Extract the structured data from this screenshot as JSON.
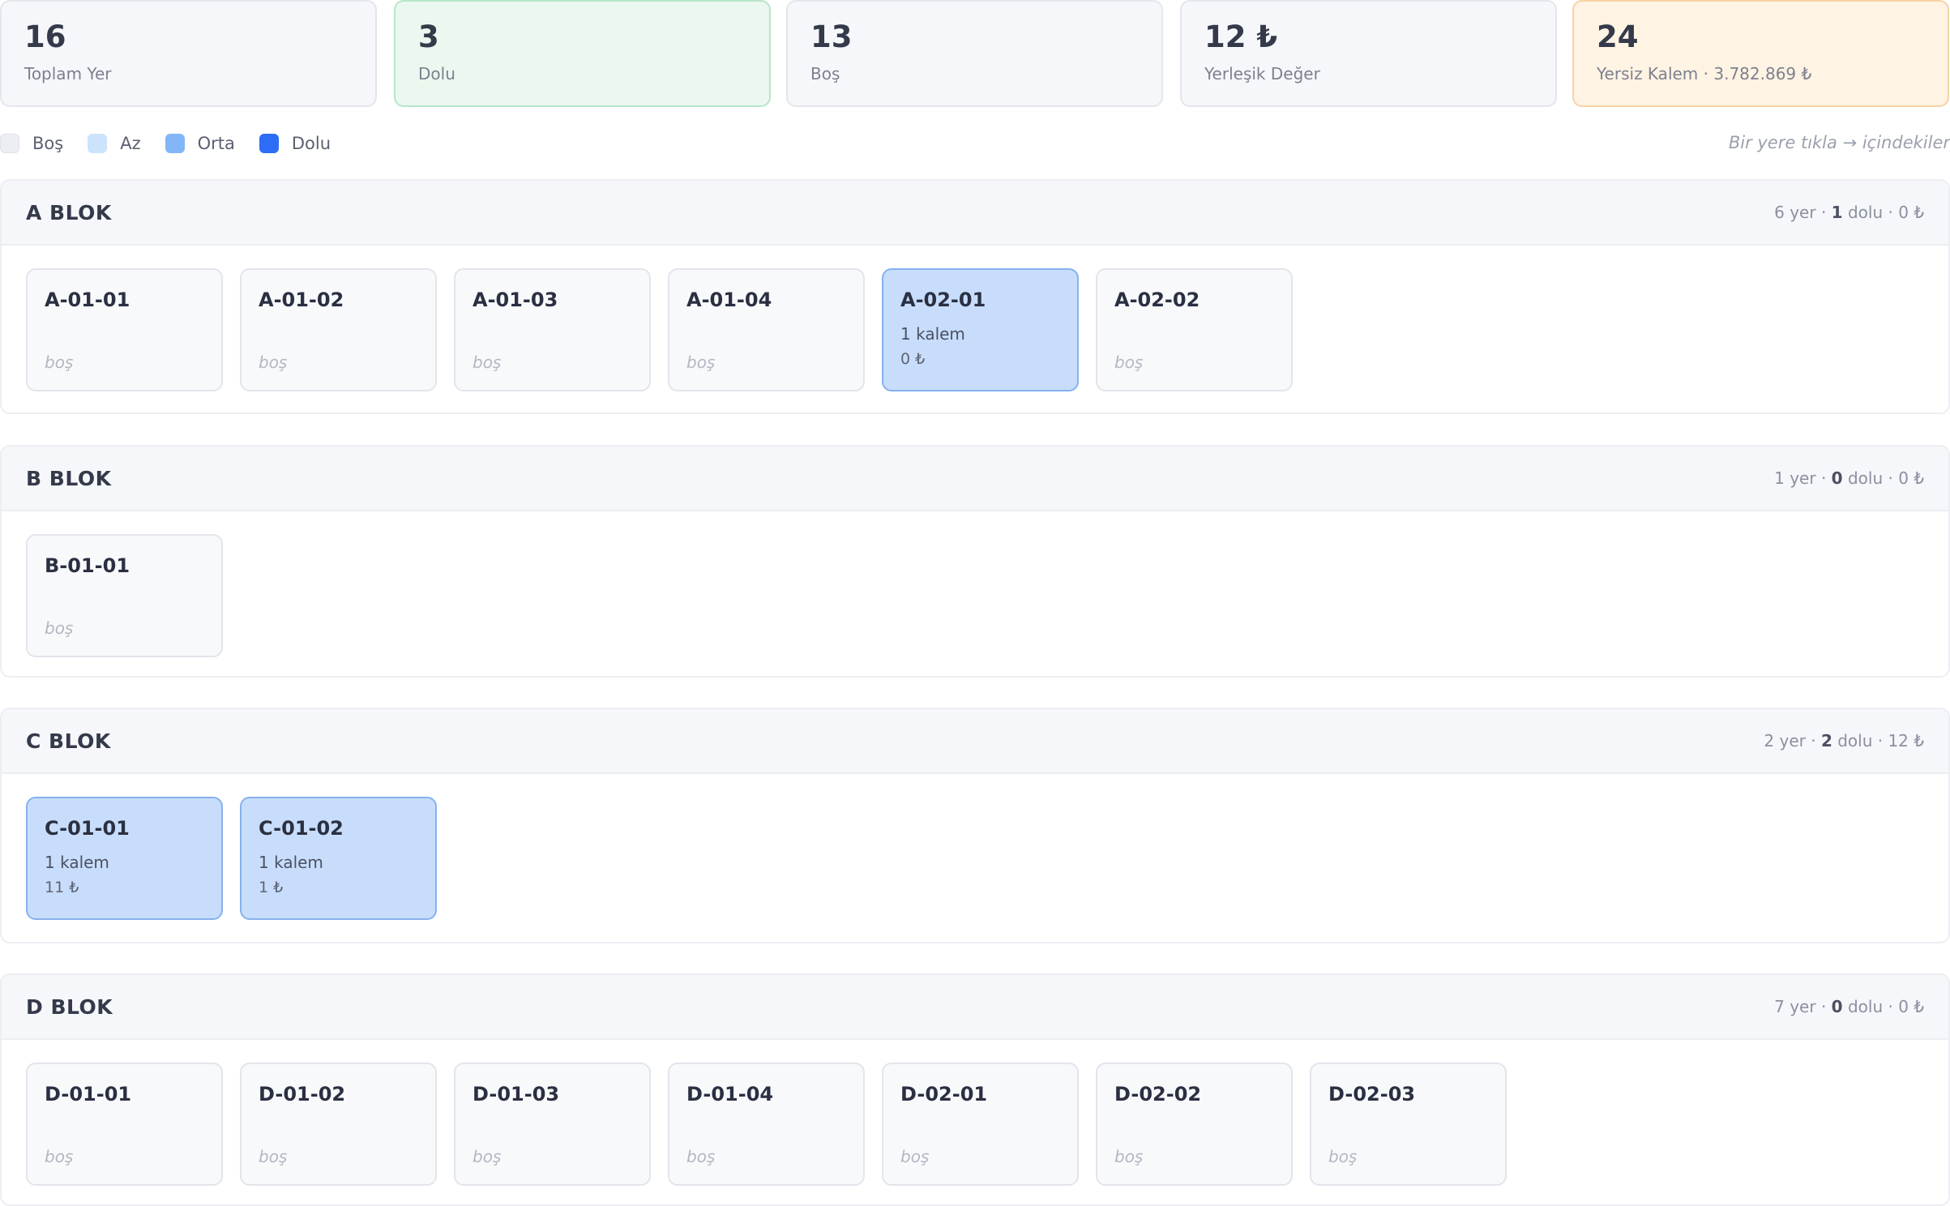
{
  "stats": [
    {
      "value": "16",
      "label": "Toplam Yer",
      "tone": "neutral"
    },
    {
      "value": "3",
      "label": "Dolu",
      "tone": "green"
    },
    {
      "value": "13",
      "label": "Boş",
      "tone": "neutral"
    },
    {
      "value": "12 ₺",
      "label": "Yerleşik Değer",
      "tone": "neutral"
    },
    {
      "value": "24",
      "label": "Yersiz Kalem · 3.782.869 ₺",
      "tone": "orange"
    }
  ],
  "legend": {
    "items": [
      {
        "label": "Boş",
        "color": "#eceef3"
      },
      {
        "label": "Az",
        "color": "#cce3fc"
      },
      {
        "label": "Orta",
        "color": "#82b6f6"
      },
      {
        "label": "Dolu",
        "color": "#2d6df6"
      }
    ],
    "hint": "Bir yere tıkla → içindekiler"
  },
  "empty_label": "boş",
  "blocks": [
    {
      "title": "A BLOK",
      "meta": {
        "places": "6 yer ·",
        "filled": "1",
        "rest": "dolu · 0 ₺"
      },
      "slots": [
        {
          "code": "A-01-01",
          "empty": true
        },
        {
          "code": "A-01-02",
          "empty": true
        },
        {
          "code": "A-01-03",
          "empty": true
        },
        {
          "code": "A-01-04",
          "empty": true
        },
        {
          "code": "A-02-01",
          "empty": false,
          "items": "1 kalem",
          "value": "0 ₺"
        },
        {
          "code": "A-02-02",
          "empty": true
        }
      ]
    },
    {
      "title": "B BLOK",
      "meta": {
        "places": "1 yer ·",
        "filled": "0",
        "rest": "dolu · 0 ₺"
      },
      "slots": [
        {
          "code": "B-01-01",
          "empty": true
        }
      ]
    },
    {
      "title": "C BLOK",
      "meta": {
        "places": "2 yer ·",
        "filled": "2",
        "rest": "dolu · 12 ₺"
      },
      "slots": [
        {
          "code": "C-01-01",
          "empty": false,
          "items": "1 kalem",
          "value": "11 ₺"
        },
        {
          "code": "C-01-02",
          "empty": false,
          "items": "1 kalem",
          "value": "1 ₺"
        }
      ]
    },
    {
      "title": "D BLOK",
      "meta": {
        "places": "7 yer ·",
        "filled": "0",
        "rest": "dolu · 0 ₺"
      },
      "slots": [
        {
          "code": "D-01-01",
          "empty": true
        },
        {
          "code": "D-01-02",
          "empty": true
        },
        {
          "code": "D-01-03",
          "empty": true
        },
        {
          "code": "D-01-04",
          "empty": true
        },
        {
          "code": "D-02-01",
          "empty": true
        },
        {
          "code": "D-02-02",
          "empty": true
        },
        {
          "code": "D-02-03",
          "empty": true
        }
      ]
    }
  ]
}
